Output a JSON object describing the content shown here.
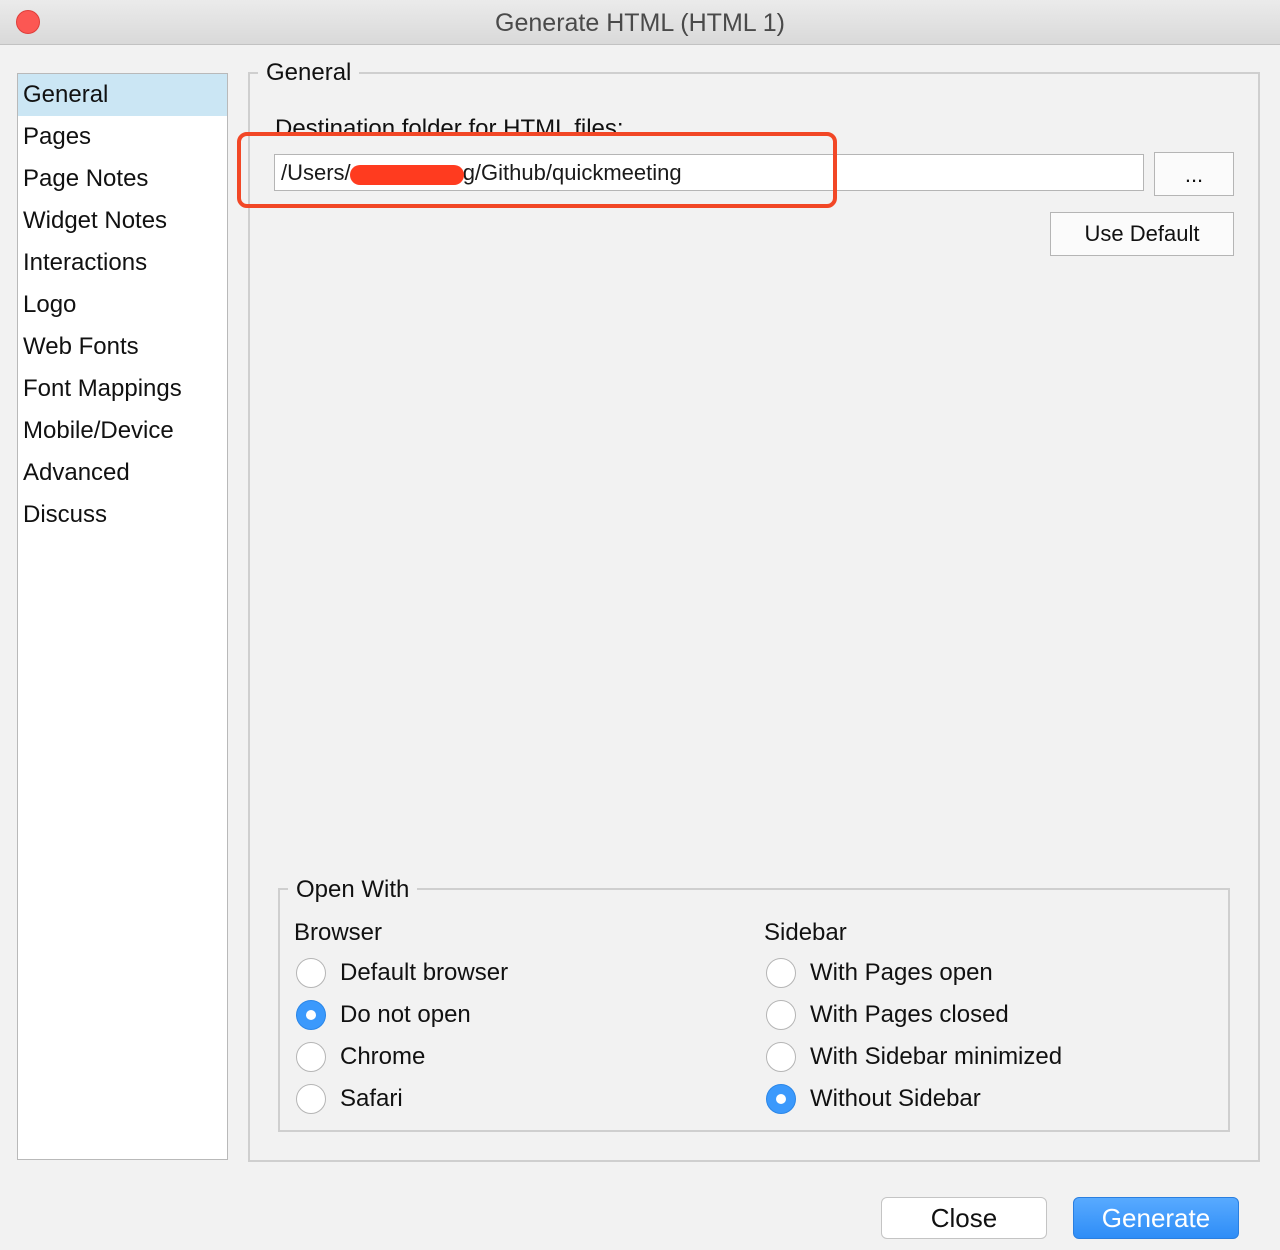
{
  "window": {
    "title": "Generate HTML (HTML 1)"
  },
  "sidebar": {
    "items": [
      {
        "label": "General",
        "selected": true
      },
      {
        "label": "Pages"
      },
      {
        "label": "Page Notes"
      },
      {
        "label": "Widget Notes"
      },
      {
        "label": "Interactions"
      },
      {
        "label": "Logo"
      },
      {
        "label": "Web Fonts"
      },
      {
        "label": "Font Mappings"
      },
      {
        "label": "Mobile/Device"
      },
      {
        "label": "Advanced"
      },
      {
        "label": "Discuss"
      }
    ]
  },
  "general": {
    "title": "General",
    "destination_label": "Destination folder for HTML files:",
    "path_prefix": "/Users/",
    "path_suffix": "g/Github/quickmeeting",
    "browse_label": "...",
    "use_default_label": "Use Default"
  },
  "open_with": {
    "title": "Open With",
    "browser": {
      "heading": "Browser",
      "options": [
        {
          "label": "Default browser",
          "checked": false
        },
        {
          "label": "Do not open",
          "checked": true
        },
        {
          "label": "Chrome",
          "checked": false
        },
        {
          "label": "Safari",
          "checked": false
        }
      ]
    },
    "sidebar": {
      "heading": "Sidebar",
      "options": [
        {
          "label": "With Pages open",
          "checked": false
        },
        {
          "label": "With Pages closed",
          "checked": false
        },
        {
          "label": "With Sidebar minimized",
          "checked": false
        },
        {
          "label": "Without Sidebar",
          "checked": true
        }
      ]
    }
  },
  "footer": {
    "close_label": "Close",
    "generate_label": "Generate"
  },
  "colors": {
    "accent": "#3b99fc",
    "selection": "#cbe6f4",
    "annotation": "#f24726",
    "window_close": "#fc5753"
  }
}
